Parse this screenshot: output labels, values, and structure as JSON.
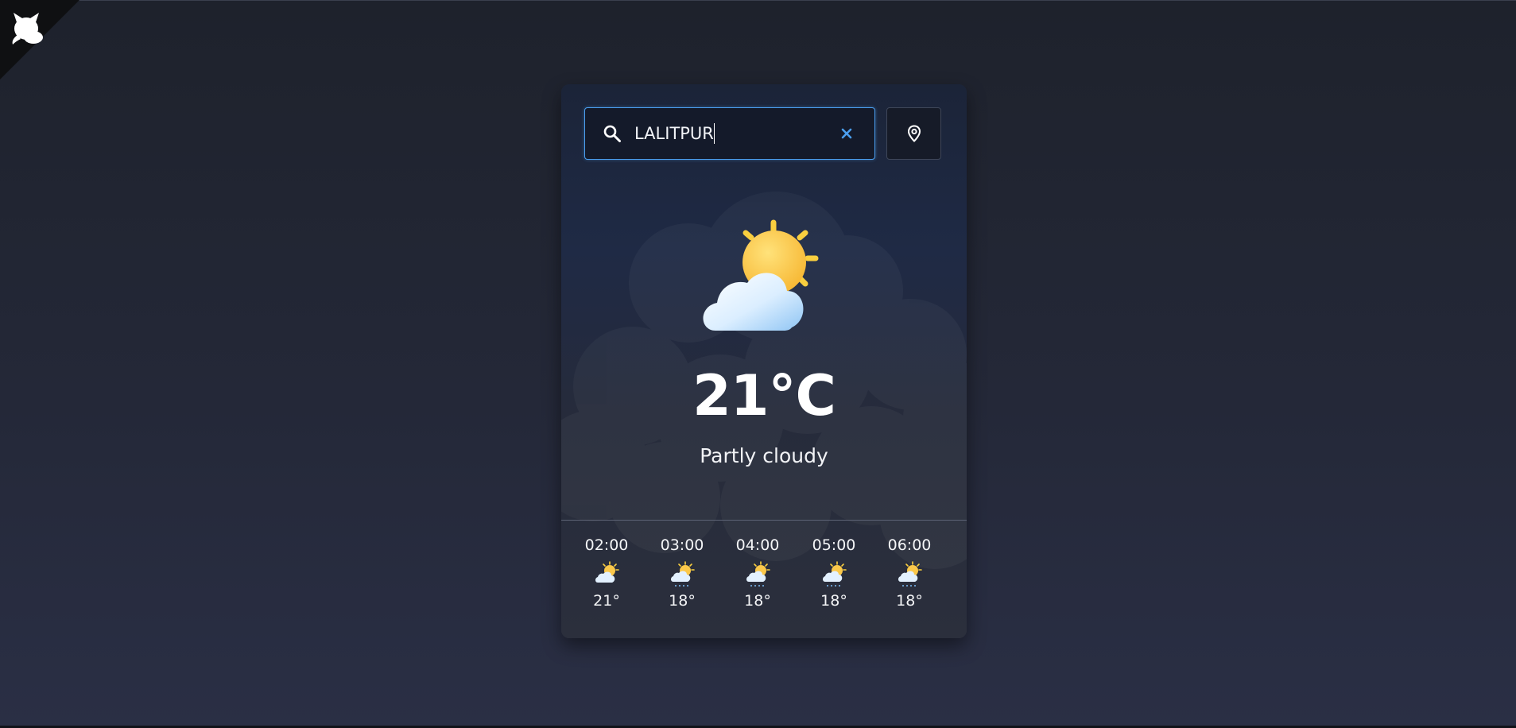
{
  "corner_badge": {
    "icon": "cat-icon"
  },
  "search": {
    "icon": "search-icon",
    "value": "LALITPUR",
    "clear_icon": "close-icon",
    "accent_color": "#4b9ff0"
  },
  "location_button": {
    "icon": "location-pin-icon"
  },
  "current": {
    "icon": "partly-cloudy-icon",
    "temperature": "21°C",
    "condition": "Partly cloudy"
  },
  "hourly": [
    {
      "time": "02:00",
      "icon": "partly-cloudy-icon",
      "temp": "21°"
    },
    {
      "time": "03:00",
      "icon": "partly-cloudy-rain-icon",
      "temp": "18°"
    },
    {
      "time": "04:00",
      "icon": "partly-cloudy-rain-icon",
      "temp": "18°"
    },
    {
      "time": "05:00",
      "icon": "partly-cloudy-rain-icon",
      "temp": "18°"
    },
    {
      "time": "06:00",
      "icon": "partly-cloudy-rain-icon",
      "temp": "18°"
    }
  ]
}
